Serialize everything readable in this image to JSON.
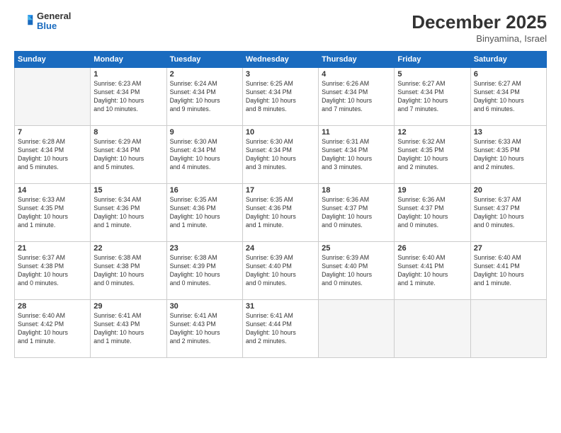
{
  "header": {
    "logo_general": "General",
    "logo_blue": "Blue",
    "month_title": "December 2025",
    "location": "Binyamina, Israel"
  },
  "days_of_week": [
    "Sunday",
    "Monday",
    "Tuesday",
    "Wednesday",
    "Thursday",
    "Friday",
    "Saturday"
  ],
  "weeks": [
    [
      {
        "day": "",
        "info": ""
      },
      {
        "day": "1",
        "info": "Sunrise: 6:23 AM\nSunset: 4:34 PM\nDaylight: 10 hours\nand 10 minutes."
      },
      {
        "day": "2",
        "info": "Sunrise: 6:24 AM\nSunset: 4:34 PM\nDaylight: 10 hours\nand 9 minutes."
      },
      {
        "day": "3",
        "info": "Sunrise: 6:25 AM\nSunset: 4:34 PM\nDaylight: 10 hours\nand 8 minutes."
      },
      {
        "day": "4",
        "info": "Sunrise: 6:26 AM\nSunset: 4:34 PM\nDaylight: 10 hours\nand 7 minutes."
      },
      {
        "day": "5",
        "info": "Sunrise: 6:27 AM\nSunset: 4:34 PM\nDaylight: 10 hours\nand 7 minutes."
      },
      {
        "day": "6",
        "info": "Sunrise: 6:27 AM\nSunset: 4:34 PM\nDaylight: 10 hours\nand 6 minutes."
      }
    ],
    [
      {
        "day": "7",
        "info": "Sunrise: 6:28 AM\nSunset: 4:34 PM\nDaylight: 10 hours\nand 5 minutes."
      },
      {
        "day": "8",
        "info": "Sunrise: 6:29 AM\nSunset: 4:34 PM\nDaylight: 10 hours\nand 5 minutes."
      },
      {
        "day": "9",
        "info": "Sunrise: 6:30 AM\nSunset: 4:34 PM\nDaylight: 10 hours\nand 4 minutes."
      },
      {
        "day": "10",
        "info": "Sunrise: 6:30 AM\nSunset: 4:34 PM\nDaylight: 10 hours\nand 3 minutes."
      },
      {
        "day": "11",
        "info": "Sunrise: 6:31 AM\nSunset: 4:34 PM\nDaylight: 10 hours\nand 3 minutes."
      },
      {
        "day": "12",
        "info": "Sunrise: 6:32 AM\nSunset: 4:35 PM\nDaylight: 10 hours\nand 2 minutes."
      },
      {
        "day": "13",
        "info": "Sunrise: 6:33 AM\nSunset: 4:35 PM\nDaylight: 10 hours\nand 2 minutes."
      }
    ],
    [
      {
        "day": "14",
        "info": "Sunrise: 6:33 AM\nSunset: 4:35 PM\nDaylight: 10 hours\nand 1 minute."
      },
      {
        "day": "15",
        "info": "Sunrise: 6:34 AM\nSunset: 4:36 PM\nDaylight: 10 hours\nand 1 minute."
      },
      {
        "day": "16",
        "info": "Sunrise: 6:35 AM\nSunset: 4:36 PM\nDaylight: 10 hours\nand 1 minute."
      },
      {
        "day": "17",
        "info": "Sunrise: 6:35 AM\nSunset: 4:36 PM\nDaylight: 10 hours\nand 1 minute."
      },
      {
        "day": "18",
        "info": "Sunrise: 6:36 AM\nSunset: 4:37 PM\nDaylight: 10 hours\nand 0 minutes."
      },
      {
        "day": "19",
        "info": "Sunrise: 6:36 AM\nSunset: 4:37 PM\nDaylight: 10 hours\nand 0 minutes."
      },
      {
        "day": "20",
        "info": "Sunrise: 6:37 AM\nSunset: 4:37 PM\nDaylight: 10 hours\nand 0 minutes."
      }
    ],
    [
      {
        "day": "21",
        "info": "Sunrise: 6:37 AM\nSunset: 4:38 PM\nDaylight: 10 hours\nand 0 minutes."
      },
      {
        "day": "22",
        "info": "Sunrise: 6:38 AM\nSunset: 4:38 PM\nDaylight: 10 hours\nand 0 minutes."
      },
      {
        "day": "23",
        "info": "Sunrise: 6:38 AM\nSunset: 4:39 PM\nDaylight: 10 hours\nand 0 minutes."
      },
      {
        "day": "24",
        "info": "Sunrise: 6:39 AM\nSunset: 4:40 PM\nDaylight: 10 hours\nand 0 minutes."
      },
      {
        "day": "25",
        "info": "Sunrise: 6:39 AM\nSunset: 4:40 PM\nDaylight: 10 hours\nand 0 minutes."
      },
      {
        "day": "26",
        "info": "Sunrise: 6:40 AM\nSunset: 4:41 PM\nDaylight: 10 hours\nand 1 minute."
      },
      {
        "day": "27",
        "info": "Sunrise: 6:40 AM\nSunset: 4:41 PM\nDaylight: 10 hours\nand 1 minute."
      }
    ],
    [
      {
        "day": "28",
        "info": "Sunrise: 6:40 AM\nSunset: 4:42 PM\nDaylight: 10 hours\nand 1 minute."
      },
      {
        "day": "29",
        "info": "Sunrise: 6:41 AM\nSunset: 4:43 PM\nDaylight: 10 hours\nand 1 minute."
      },
      {
        "day": "30",
        "info": "Sunrise: 6:41 AM\nSunset: 4:43 PM\nDaylight: 10 hours\nand 2 minutes."
      },
      {
        "day": "31",
        "info": "Sunrise: 6:41 AM\nSunset: 4:44 PM\nDaylight: 10 hours\nand 2 minutes."
      },
      {
        "day": "",
        "info": ""
      },
      {
        "day": "",
        "info": ""
      },
      {
        "day": "",
        "info": ""
      }
    ]
  ]
}
